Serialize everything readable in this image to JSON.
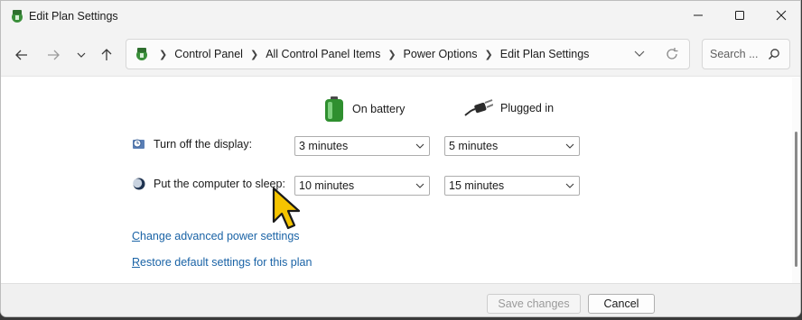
{
  "window": {
    "title": "Edit Plan Settings"
  },
  "addressbar": {
    "crumbs": [
      "Control Panel",
      "All Control Panel Items",
      "Power Options",
      "Edit Plan Settings"
    ]
  },
  "search": {
    "placeholder": "Search ..."
  },
  "columns": {
    "battery": "On battery",
    "plugged": "Plugged in"
  },
  "rows": {
    "display": {
      "label": "Turn off the display:",
      "battery": "3 minutes",
      "plugged": "5 minutes"
    },
    "sleep": {
      "label": "Put the computer to sleep:",
      "battery": "10 minutes",
      "plugged": "15 minutes"
    }
  },
  "links": {
    "advanced_first": "C",
    "advanced_rest": "hange advanced power settings",
    "restore_first": "R",
    "restore_rest": "estore default settings for this plan"
  },
  "buttons": {
    "save": "Save changes",
    "cancel": "Cancel"
  },
  "colors": {
    "link": "#1a63a6",
    "battery_green": "#3aa83a",
    "cursor_yellow": "#f5c400"
  }
}
